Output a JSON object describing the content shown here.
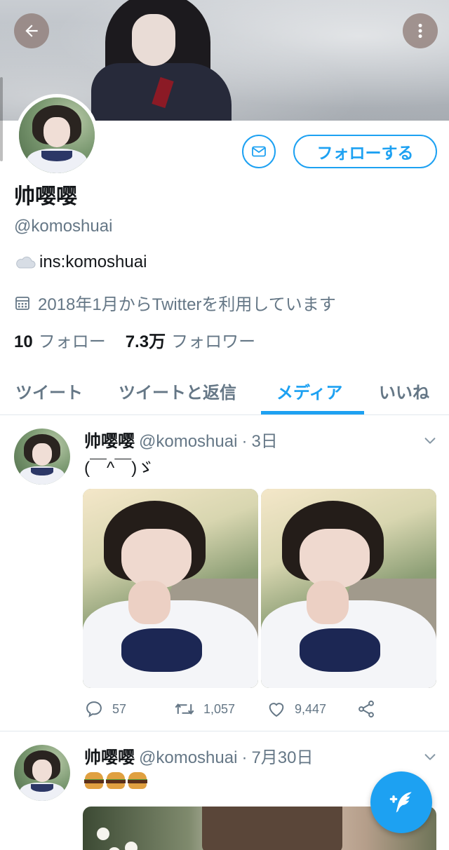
{
  "header": {
    "back_icon": "arrow-left-icon",
    "menu_icon": "more-vertical-icon"
  },
  "profile": {
    "display_name": "帅嘤嘤",
    "handle": "@komoshuai",
    "bio": "ins:komoshuai",
    "bio_icon": "cloud-emoji",
    "joined": "2018年1月からTwitterを利用しています",
    "following_count": "10",
    "following_label": "フォロー",
    "followers_count": "7.3万",
    "followers_label": "フォロワー"
  },
  "buttons": {
    "message_icon": "mail-icon",
    "follow_label": "フォローする"
  },
  "tabs": [
    {
      "label": "ツイート",
      "active": false
    },
    {
      "label": "ツイートと返信",
      "active": false
    },
    {
      "label": "メディア",
      "active": true
    },
    {
      "label": "いいね",
      "active": false
    }
  ],
  "tweets": [
    {
      "name": "帅嘤嘤",
      "handle": "@komoshuai",
      "separator": "·",
      "time": "3日",
      "text": "(￣^￣)ゞ",
      "replies": "57",
      "retweets": "1,057",
      "likes": "9,447"
    },
    {
      "name": "帅嘤嘤",
      "handle": "@komoshuai",
      "separator": "·",
      "time": "7月30日",
      "text_emoji": [
        "hamburger",
        "hamburger",
        "hamburger"
      ]
    }
  ],
  "fab": {
    "icon": "compose-feather-icon"
  },
  "colors": {
    "accent": "#1da1f2",
    "text": "#14171a",
    "muted": "#657786",
    "border": "#e1e8ed"
  }
}
